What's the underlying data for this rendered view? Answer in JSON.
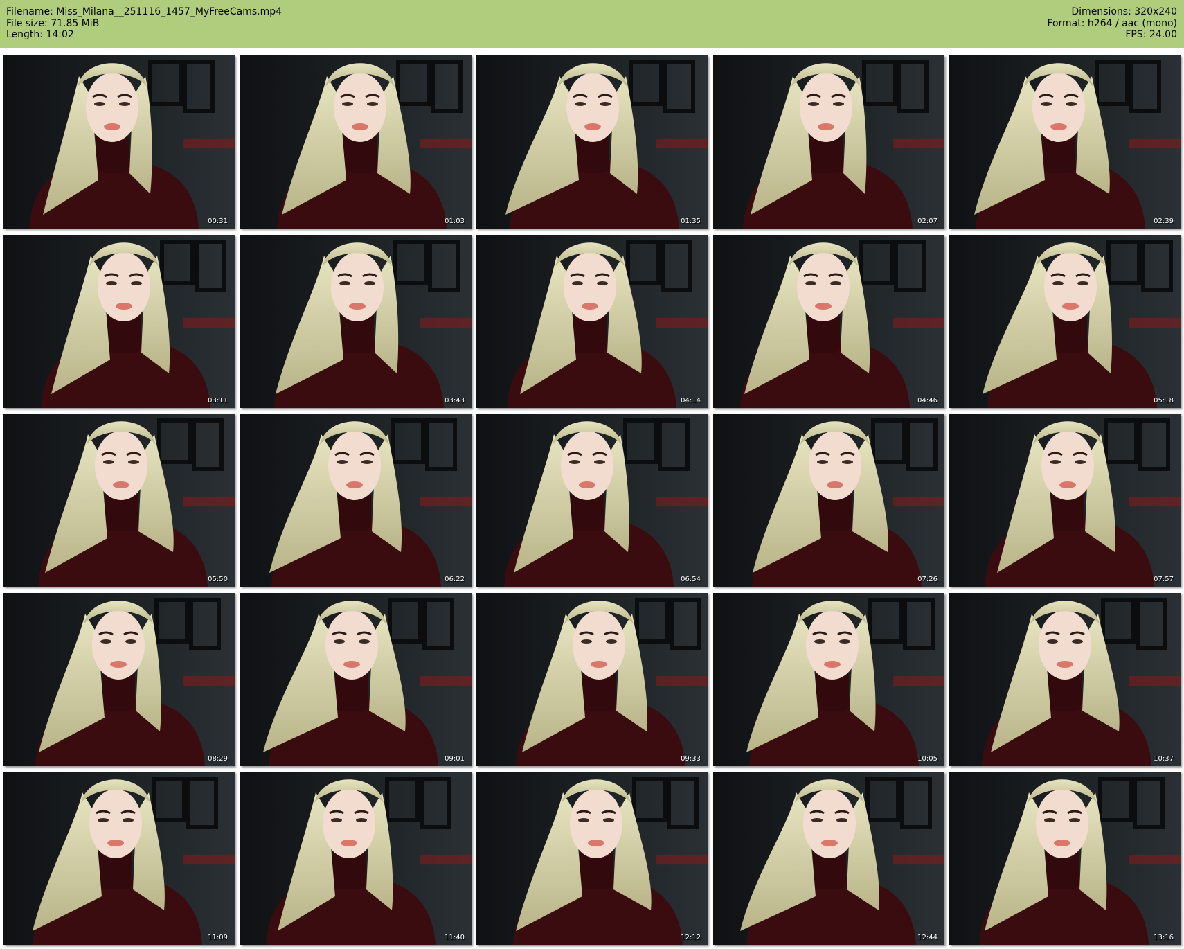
{
  "header": {
    "filename": "Filename: Miss_Milana__251116_1457_MyFreeCams.mp4",
    "file_size": "File size: 71.85 MiB",
    "length": "Length: 14:02",
    "dimensions": "Dimensions: 320x240",
    "format": "Format: h264 / aac (mono)",
    "fps": "FPS: 24.00"
  },
  "colors": {
    "header_bg": "#b0cd7e",
    "sweater": "#3a0c10",
    "hair": "#d8d6a6",
    "background": "#1b1f22"
  },
  "thumbnails": [
    {
      "time": "00:31"
    },
    {
      "time": "01:03"
    },
    {
      "time": "01:35"
    },
    {
      "time": "02:07"
    },
    {
      "time": "02:39"
    },
    {
      "time": "03:11"
    },
    {
      "time": "03:43"
    },
    {
      "time": "04:14"
    },
    {
      "time": "04:46"
    },
    {
      "time": "05:18"
    },
    {
      "time": "05:50"
    },
    {
      "time": "06:22"
    },
    {
      "time": "06:54"
    },
    {
      "time": "07:26"
    },
    {
      "time": "07:57"
    },
    {
      "time": "08:29"
    },
    {
      "time": "09:01"
    },
    {
      "time": "09:33"
    },
    {
      "time": "10:05"
    },
    {
      "time": "10:37"
    },
    {
      "time": "11:09"
    },
    {
      "time": "11:40"
    },
    {
      "time": "12:12"
    },
    {
      "time": "12:44"
    },
    {
      "time": "13:16"
    }
  ]
}
